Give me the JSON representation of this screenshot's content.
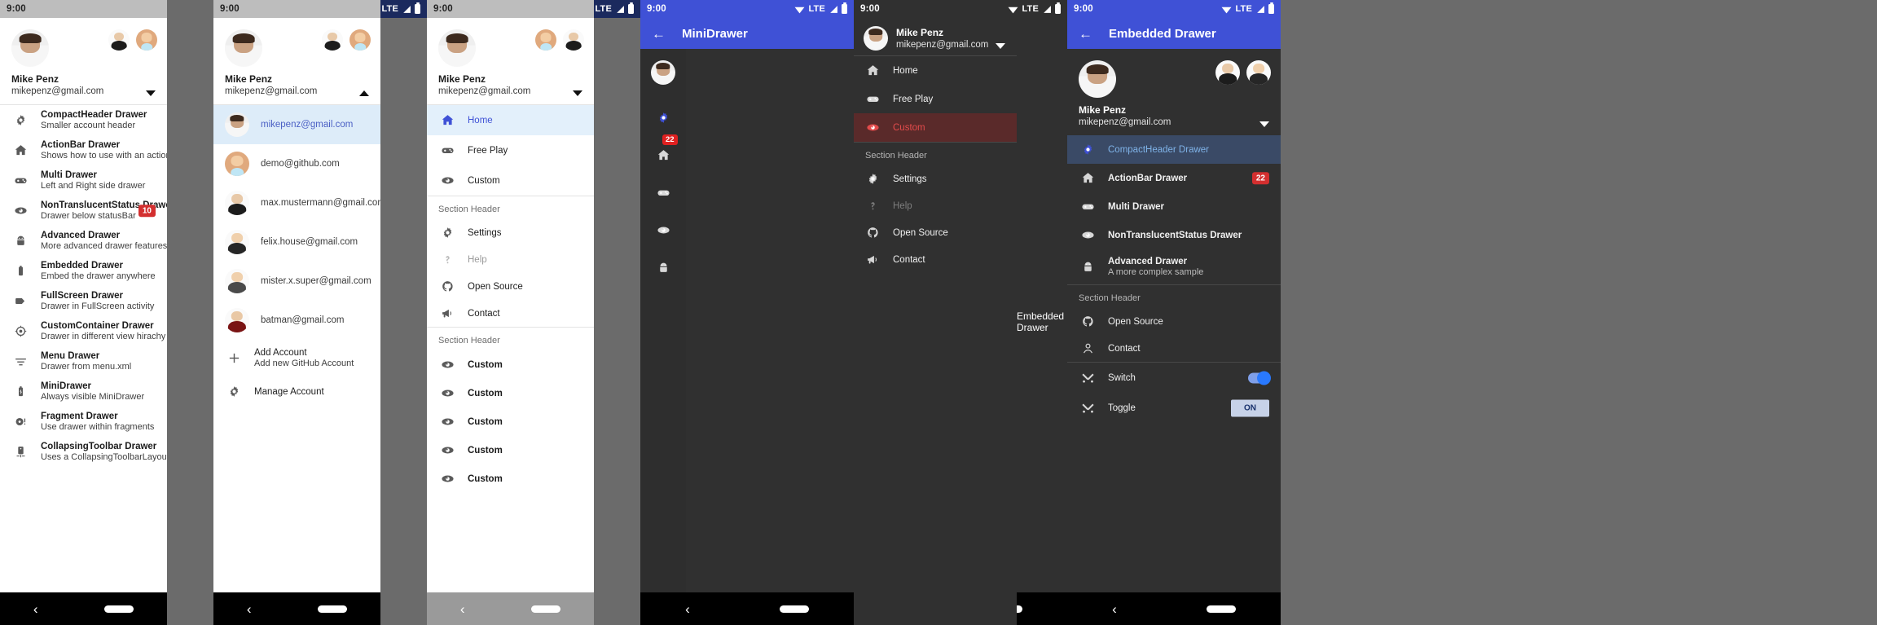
{
  "meta": {
    "clock": "9:00",
    "lte_label": "LTE",
    "accent_blue": "#3f51d6",
    "accent_red": "#e34b4b",
    "badge_red": "#d32f2f"
  },
  "account": {
    "name": "Mike Penz",
    "email": "mikepenz@gmail.com"
  },
  "panel1": {
    "items": [
      {
        "title": "CompactHeader Drawer",
        "subtitle": "Smaller account header",
        "icon": "gear-icon"
      },
      {
        "title": "ActionBar Drawer",
        "subtitle": "Shows how to use with an actionbar",
        "icon": "home-icon"
      },
      {
        "title": "Multi Drawer",
        "subtitle": "Left and Right side drawer",
        "icon": "gamepad-icon"
      },
      {
        "title": "NonTranslucentStatus Drawer",
        "subtitle": "Drawer below statusBar",
        "icon": "eye-icon",
        "badge": "10"
      },
      {
        "title": "Advanced Drawer",
        "subtitle": "More advanced drawer features",
        "icon": "android-icon"
      },
      {
        "title": "Embedded Drawer",
        "subtitle": "Embed the drawer anywhere",
        "icon": "battery-icon"
      },
      {
        "title": "FullScreen Drawer",
        "subtitle": "Drawer in FullScreen activity",
        "icon": "tag-icon"
      },
      {
        "title": "CustomContainer Drawer",
        "subtitle": "Drawer in different view hirachy",
        "icon": "target-icon"
      },
      {
        "title": "Menu Drawer",
        "subtitle": "Drawer from menu.xml",
        "icon": "filter-icon"
      },
      {
        "title": "MiniDrawer",
        "subtitle": "Always visible MiniDrawer",
        "icon": "battery-charging-icon"
      },
      {
        "title": "Fragment Drawer",
        "subtitle": "Use drawer within fragments",
        "icon": "disc-alert-icon"
      },
      {
        "title": "CollapsingToolbar Drawer",
        "subtitle": "Uses a CollapsingToolbarLayout",
        "icon": "phone-link-icon"
      }
    ]
  },
  "panel2": {
    "accounts": [
      {
        "email": "mikepenz@gmail.com",
        "selected": true,
        "avatar": "face-mike"
      },
      {
        "email": "demo@github.com",
        "selected": false,
        "avatar": "face-demo"
      },
      {
        "email": "max.mustermann@gmail.com",
        "selected": false,
        "avatar": "face-max"
      },
      {
        "email": "felix.house@gmail.com",
        "selected": false,
        "avatar": "face-felix"
      },
      {
        "email": "mister.x.super@gmail.com",
        "selected": false,
        "avatar": "face-mister"
      },
      {
        "email": "batman@gmail.com",
        "selected": false,
        "avatar": "face-batman"
      }
    ],
    "actions": [
      {
        "title": "Add Account",
        "subtitle": "Add new GitHub Account",
        "icon": "plus-icon"
      },
      {
        "title": "Manage Account",
        "subtitle": "",
        "icon": "gear-icon"
      }
    ]
  },
  "panel3": {
    "primary": [
      {
        "label": "Home",
        "icon": "home-icon",
        "selected": true,
        "disabled": false
      },
      {
        "label": "Free Play",
        "icon": "gamepad-icon",
        "selected": false,
        "disabled": false
      },
      {
        "label": "Custom",
        "icon": "eye-icon",
        "selected": false,
        "disabled": false
      }
    ],
    "section_label": "Section Header",
    "secondary": [
      {
        "label": "Settings",
        "icon": "gear-icon",
        "disabled": false
      },
      {
        "label": "Help",
        "icon": "question-icon",
        "disabled": true
      },
      {
        "label": "Open Source",
        "icon": "github-icon",
        "disabled": false
      },
      {
        "label": "Contact",
        "icon": "megaphone-icon",
        "disabled": false
      }
    ],
    "section_label2": "Section Header",
    "customs": [
      {
        "label": "Custom",
        "icon": "eye-icon"
      },
      {
        "label": "Custom",
        "icon": "eye-icon"
      },
      {
        "label": "Custom",
        "icon": "eye-icon"
      },
      {
        "label": "Custom",
        "icon": "eye-icon"
      },
      {
        "label": "Custom",
        "icon": "eye-icon"
      }
    ]
  },
  "panel4": {
    "appbar_title": "MiniDrawer",
    "body_text": "",
    "rail": [
      {
        "icon": "avatar-icon",
        "badge": ""
      },
      {
        "icon": "gear-icon",
        "badge": "",
        "accent": true
      },
      {
        "icon": "home-icon",
        "badge": "22"
      },
      {
        "icon": "gamepad-icon",
        "badge": ""
      },
      {
        "icon": "eye-icon",
        "badge": ""
      },
      {
        "icon": "android-icon",
        "badge": ""
      }
    ]
  },
  "panel5": {
    "primary": [
      {
        "label": "Home",
        "icon": "home-icon",
        "selected": false,
        "disabled": false
      },
      {
        "label": "Free Play",
        "icon": "gamepad-icon",
        "selected": false,
        "disabled": false
      },
      {
        "label": "Custom",
        "icon": "eye-icon",
        "selected": true,
        "disabled": false
      }
    ],
    "section_label": "Section Header",
    "secondary": [
      {
        "label": "Settings",
        "icon": "gear-icon",
        "disabled": false
      },
      {
        "label": "Help",
        "icon": "question-icon",
        "disabled": true
      },
      {
        "label": "Open Source",
        "icon": "github-icon",
        "disabled": false
      },
      {
        "label": "Contact",
        "icon": "megaphone-icon",
        "disabled": false
      }
    ],
    "body_text": "Embedded Drawer"
  },
  "panel6": {
    "appbar_title": "Embedded Drawer",
    "items": [
      {
        "title": "CompactHeader Drawer",
        "subtitle": "",
        "icon": "gear-icon",
        "selected": true
      },
      {
        "title": "ActionBar Drawer",
        "subtitle": "",
        "icon": "home-icon",
        "badge": "22"
      },
      {
        "title": "Multi Drawer",
        "subtitle": "",
        "icon": "gamepad-icon"
      },
      {
        "title": "NonTranslucentStatus Drawer",
        "subtitle": "",
        "icon": "eye-icon"
      },
      {
        "title": "Advanced Drawer",
        "subtitle": "A more complex sample",
        "icon": "android-icon"
      }
    ],
    "section_label": "Section Header",
    "secondary": [
      {
        "title": "Open Source",
        "icon": "github-icon"
      },
      {
        "title": "Contact",
        "icon": "contact-icon"
      }
    ],
    "switches": [
      {
        "label": "Switch",
        "icon": "tools-icon",
        "kind": "toggle"
      },
      {
        "label": "Toggle",
        "icon": "tools-icon",
        "kind": "button",
        "value": "ON"
      }
    ]
  }
}
